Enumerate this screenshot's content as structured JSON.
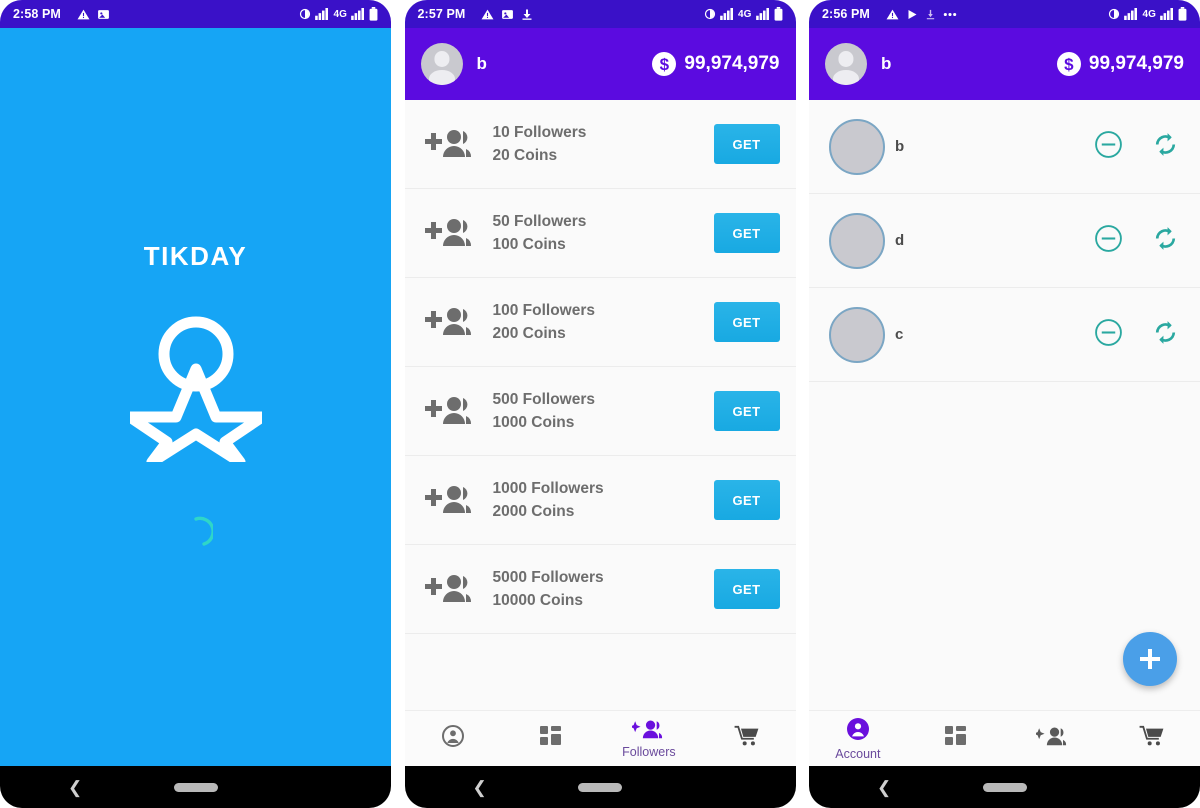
{
  "panels": {
    "splash": {
      "status": {
        "time": "2:58 PM",
        "network": "4G"
      },
      "brand": "TIKDAY"
    },
    "followers": {
      "status": {
        "time": "2:57 PM",
        "network": "4G"
      },
      "appbar": {
        "username": "b",
        "balance": "99,974,979",
        "coin_symbol": "$"
      },
      "offers": [
        {
          "followers": "10 Followers",
          "coins": "20 Coins",
          "action": "GET"
        },
        {
          "followers": "50 Followers",
          "coins": "100 Coins",
          "action": "GET"
        },
        {
          "followers": "100 Followers",
          "coins": "200 Coins",
          "action": "GET"
        },
        {
          "followers": "500 Followers",
          "coins": "1000 Coins",
          "action": "GET"
        },
        {
          "followers": "1000 Followers",
          "coins": "2000 Coins",
          "action": "GET"
        },
        {
          "followers": "5000 Followers",
          "coins": "10000 Coins",
          "action": "GET"
        }
      ],
      "nav": [
        {
          "icon": "account-icon",
          "label": "",
          "active": false
        },
        {
          "icon": "dashboard-icon",
          "label": "",
          "active": false
        },
        {
          "icon": "followers-icon",
          "label": "Followers",
          "active": true
        },
        {
          "icon": "cart-icon",
          "label": "",
          "active": false
        }
      ]
    },
    "accounts": {
      "status": {
        "time": "2:56 PM",
        "network": "4G"
      },
      "appbar": {
        "username": "b",
        "balance": "99,974,979",
        "coin_symbol": "$"
      },
      "accounts": [
        {
          "name": "b"
        },
        {
          "name": "d"
        },
        {
          "name": "c"
        }
      ],
      "fab": {
        "label": "+"
      },
      "nav": [
        {
          "icon": "account-icon",
          "label": "Account",
          "active": true
        },
        {
          "icon": "dashboard-icon",
          "label": "",
          "active": false
        },
        {
          "icon": "followers-icon",
          "label": "",
          "active": false
        },
        {
          "icon": "cart-icon",
          "label": "",
          "active": false
        }
      ]
    }
  },
  "colors": {
    "statusbar": "#3a11c8",
    "appbar": "#5b0be0",
    "splash": "#16a5f5",
    "get_button": "#1fa9e4",
    "accent_purple": "#6a0fdd",
    "teal": "#2aa8a0",
    "fab": "#4a9fe8"
  }
}
